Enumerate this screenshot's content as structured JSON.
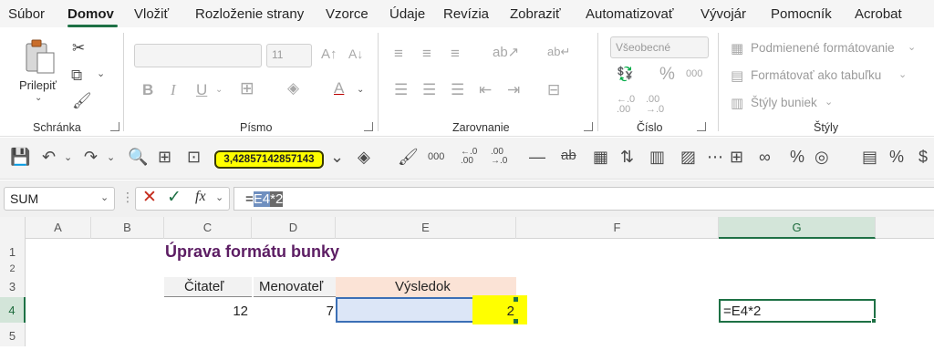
{
  "menu": {
    "items": [
      "Súbor",
      "Domov",
      "Vložiť",
      "Rozloženie strany",
      "Vzorce",
      "Údaje",
      "Revízia",
      "Zobraziť",
      "Automatizovať",
      "Vývojár",
      "Pomocník",
      "Acrobat"
    ],
    "active": "Domov"
  },
  "ribbon": {
    "clipboard": {
      "label": "Schránka",
      "paste_label": "Prilepiť"
    },
    "font": {
      "label": "Písmo",
      "size": "11"
    },
    "alignment": {
      "label": "Zarovnanie"
    },
    "number": {
      "label": "Číslo",
      "format": "Všeobecné"
    },
    "styles": {
      "label": "Štýly",
      "conditional": "Podmienené formátovanie",
      "as_table": "Formátovať ako tabuľku",
      "cell_styles": "Štýly buniek"
    }
  },
  "qat": {
    "tooltip_value": "3,42857142857143"
  },
  "formula_bar": {
    "name_box": "SUM",
    "fx": "fx",
    "formula_prefix": "=",
    "formula_ref": "E4",
    "formula_rest": "*2"
  },
  "grid": {
    "columns": [
      "A",
      "B",
      "C",
      "D",
      "E",
      "F",
      "G"
    ],
    "selected_column": "G",
    "rows": [
      "1",
      "2",
      "3",
      "4",
      "5"
    ],
    "selected_row": "4",
    "title": "Úprava formátu bunky",
    "headers": {
      "c": "Čitateľ",
      "d": "Menovateľ",
      "e": "Výsledok"
    },
    "values": {
      "c4": "12",
      "d4": "7",
      "e4": "2",
      "g4": "=E4*2"
    }
  },
  "colors": {
    "accent": "#1e7145",
    "title": "#5c1d63",
    "header_fill": "#fbe3d6",
    "highlight": "#ffff00",
    "input_fill": "#dce6f7"
  }
}
